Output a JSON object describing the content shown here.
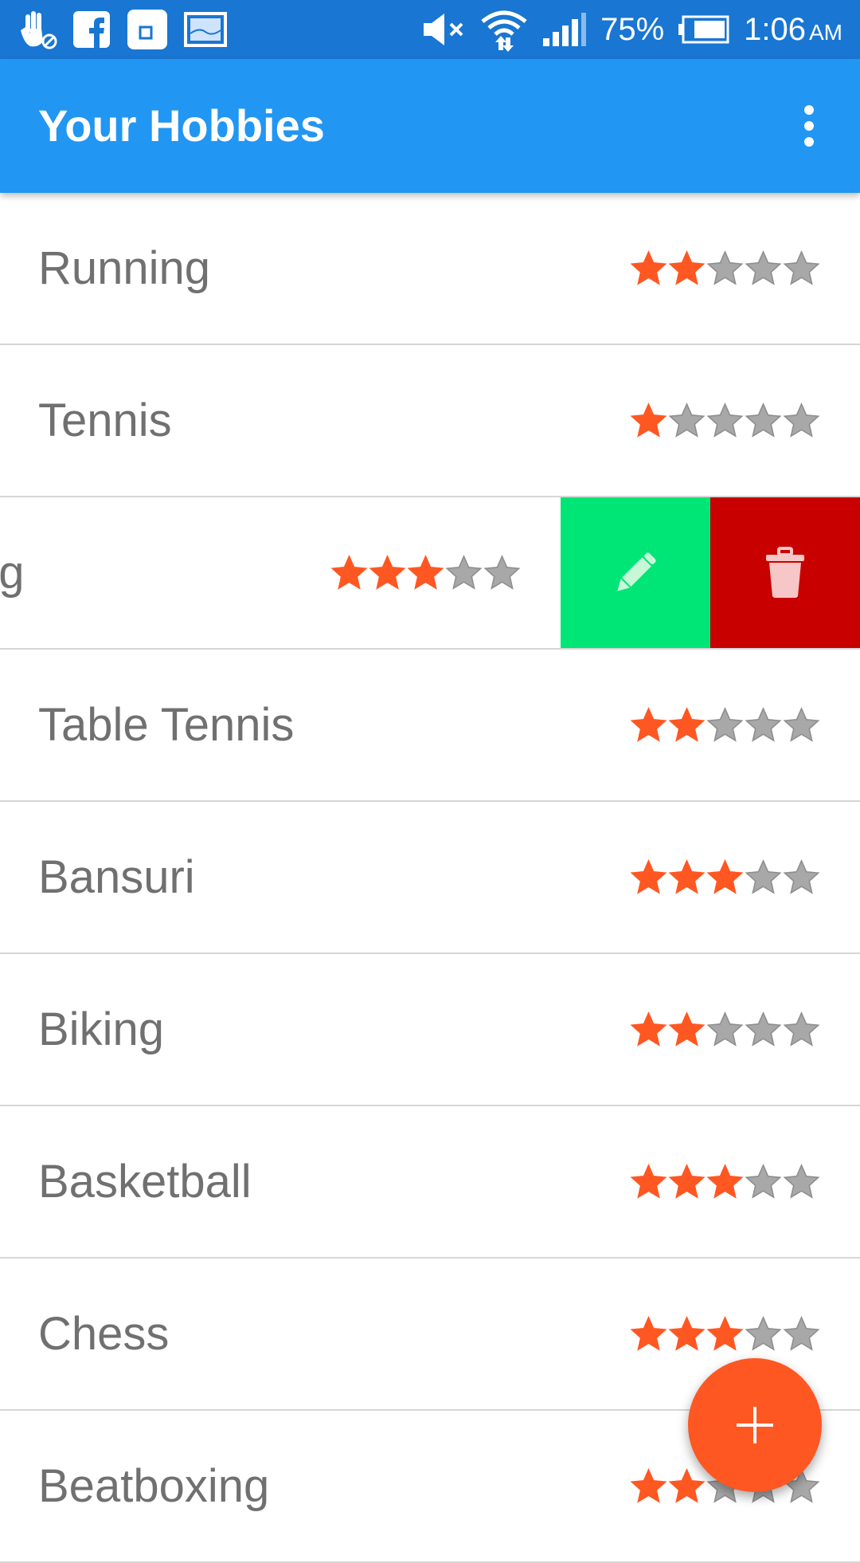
{
  "status_bar": {
    "battery_percent": "75%",
    "time": "1:06",
    "ampm": "AM",
    "icons": [
      "hand-icon",
      "facebook-icon",
      "sim-icon",
      "image-icon",
      "mute-icon",
      "wifi-icon",
      "signal-icon",
      "battery-icon"
    ]
  },
  "app_bar": {
    "title": "Your Hobbies",
    "menu_icon": "overflow-menu-icon",
    "color": "#2196f3"
  },
  "hobbies": [
    {
      "name": "Running",
      "rating": 2
    },
    {
      "name": "Tennis",
      "rating": 1
    },
    {
      "name": "ng",
      "rating": 3,
      "swiped": true
    },
    {
      "name": "Table Tennis",
      "rating": 2
    },
    {
      "name": "Bansuri",
      "rating": 3
    },
    {
      "name": "Biking",
      "rating": 2
    },
    {
      "name": "Basketball",
      "rating": 3
    },
    {
      "name": "Chess",
      "rating": 3
    },
    {
      "name": "Beatboxing",
      "rating": 2
    }
  ],
  "rating_max": 5,
  "swipe_actions": {
    "edit_icon": "pencil-icon",
    "delete_icon": "trash-icon",
    "edit_color": "#00e676",
    "delete_color": "#c80000"
  },
  "fab": {
    "icon": "plus-icon",
    "color": "#ff5722"
  },
  "colors": {
    "star_filled": "#ff5722",
    "star_empty": "#a8a8a8"
  }
}
